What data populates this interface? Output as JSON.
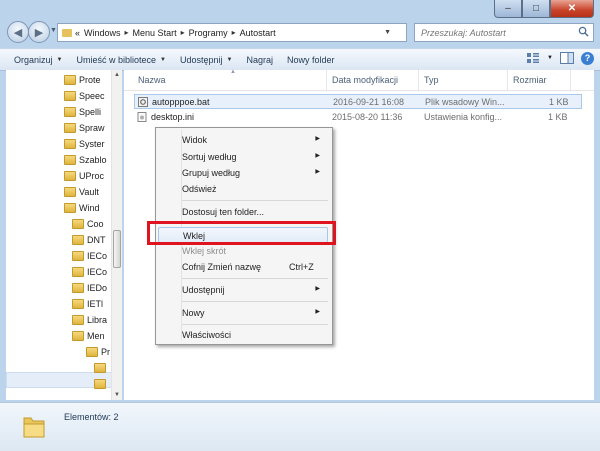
{
  "address": {
    "overflow": "«",
    "crumbs": [
      "Windows",
      "Menu Start",
      "Programy",
      "Autostart"
    ],
    "search_placeholder": "Przeszukaj: Autostart"
  },
  "toolbar": {
    "organize": "Organizuj",
    "include_library": "Umieść w bibliotece",
    "share": "Udostępnij",
    "burn": "Nagraj",
    "new_folder": "Nowy folder"
  },
  "navpane": {
    "items": [
      {
        "label": "Prote"
      },
      {
        "label": "Speec"
      },
      {
        "label": "Spelli"
      },
      {
        "label": "Spraw"
      },
      {
        "label": "Syster"
      },
      {
        "label": "Szablo"
      },
      {
        "label": "UProc"
      },
      {
        "label": "Vault"
      },
      {
        "label": "Wind"
      },
      {
        "label": "Coo"
      },
      {
        "label": "DNT"
      },
      {
        "label": "IECo"
      },
      {
        "label": "IECo"
      },
      {
        "label": "IEDo"
      },
      {
        "label": "IETl"
      },
      {
        "label": "Libra"
      },
      {
        "label": "Men"
      },
      {
        "label": "Pr"
      },
      {
        "label": ""
      },
      {
        "label": ""
      }
    ]
  },
  "columns": {
    "name": "Nazwa",
    "date": "Data modyfikacji",
    "type": "Typ",
    "size": "Rozmiar"
  },
  "files": [
    {
      "name": "autopppoe.bat",
      "date": "2016-09-21 16:08",
      "type": "Plik wsadowy Win...",
      "size": "1 KB"
    },
    {
      "name": "desktop.ini",
      "date": "2015-08-20 11:36",
      "type": "Ustawienia konfig...",
      "size": "1 KB"
    }
  ],
  "context_menu": {
    "view": "Widok",
    "sort_by": "Sortuj według",
    "group_by": "Grupuj według",
    "refresh": "Odśwież",
    "customize": "Dostosuj ten folder...",
    "paste": "Wklej",
    "paste_shortcut": "Wklej skrót",
    "undo_rename": "Cofnij Zmień nazwę",
    "undo_shortcut": "Ctrl+Z",
    "share_with": "Udostępnij",
    "new": "Nowy",
    "properties": "Właściwości"
  },
  "status": {
    "items_count": "Elementów: 2"
  },
  "colors": {
    "window_frame": "#bcd3ec",
    "highlight_box": "#e0141e",
    "selection": "#e8f1fb"
  },
  "icons": [
    "back-arrow-icon",
    "forward-arrow-icon",
    "folder-icon",
    "refresh-icon",
    "search-icon",
    "view-options-icon",
    "preview-pane-icon",
    "help-icon",
    "bat-file-icon",
    "ini-file-icon",
    "submenu-arrow-icon"
  ]
}
